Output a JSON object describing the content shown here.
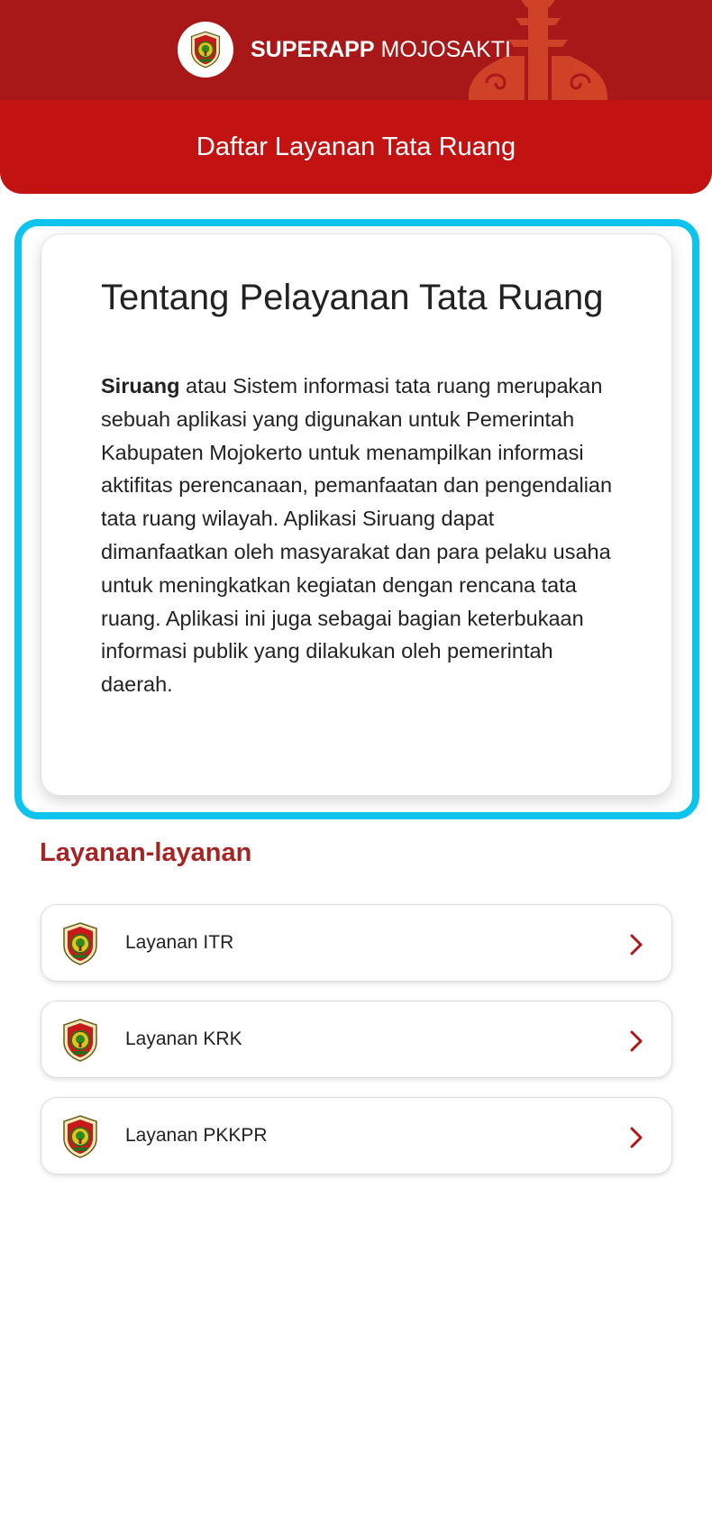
{
  "header": {
    "brand_bold": "SUPERAPP",
    "brand_regular": "MOJOSAKTI",
    "page_title": "Daftar Layanan Tata Ruang"
  },
  "about": {
    "title": "Tentang Pelayanan Tata Ruang",
    "body_bold": "Siruang",
    "body_rest": " atau Sistem informasi tata ruang merupakan sebuah aplikasi yang digunakan untuk Pemerintah Kabupaten Mojokerto untuk menampilkan informasi aktifitas perencanaan, pemanfaatan dan pengendalian tata ruang wilayah. Aplikasi Siruang dapat dimanfaatkan oleh masyarakat dan para pelaku usaha untuk meningkatkan kegiatan dengan rencana tata ruang. Aplikasi ini juga sebagai bagian keterbukaan informasi publik yang dilakukan oleh pemerintah daerah."
  },
  "services": {
    "section_title": "Layanan-layanan",
    "items": [
      {
        "label": "Layanan ITR",
        "icon": "kabupaten-mojokerto-crest-icon"
      },
      {
        "label": "Layanan KRK",
        "icon": "kabupaten-mojokerto-crest-icon"
      },
      {
        "label": "Layanan PKKPR",
        "icon": "kabupaten-mojokerto-crest-icon"
      }
    ]
  },
  "colors": {
    "header_dark": "#a81818",
    "header_red": "#c31212",
    "highlight_border": "#0fc3ef",
    "section_title": "#a52424",
    "chevron": "#b01515"
  }
}
